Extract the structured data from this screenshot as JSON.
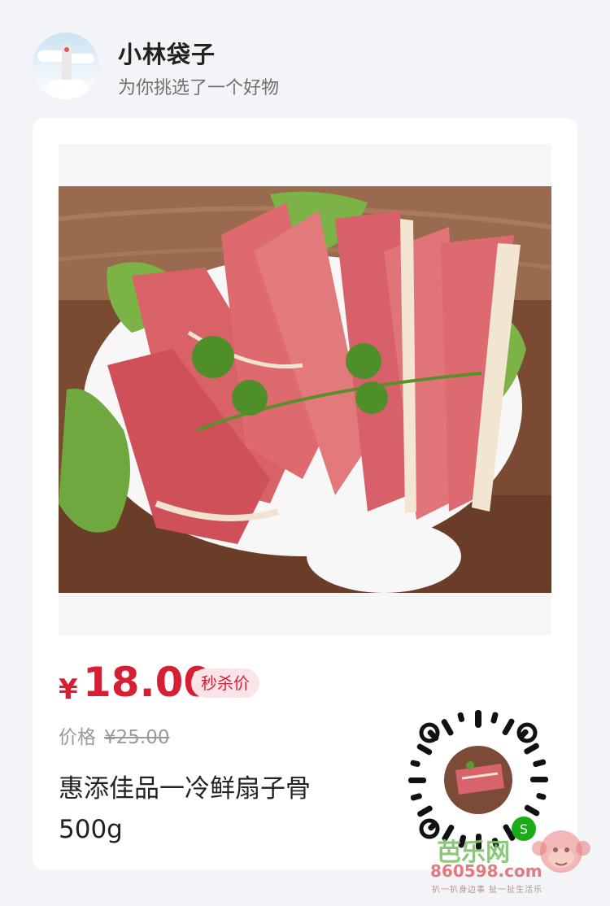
{
  "header": {
    "username": "小林袋子",
    "subtitle": "为你挑选了一个好物"
  },
  "product": {
    "currency": "¥",
    "price": "18.00",
    "price_badge": "秒杀价",
    "original_price_label": "价格",
    "original_price": "¥25.00",
    "name": "惠添佳品一冷鲜扇子骨 500g",
    "image_icon": "meat-product-photo",
    "qr_icon": "mini-program-code"
  },
  "watermark": {
    "site_name": "芭乐网",
    "domain": "860598.com",
    "slogan": "扒一扒身边事  扯一扯生活乐"
  },
  "colors": {
    "price_red": "#d71f34",
    "badge_bg": "#fbe4e8",
    "page_bg": "#f2f4f7"
  }
}
